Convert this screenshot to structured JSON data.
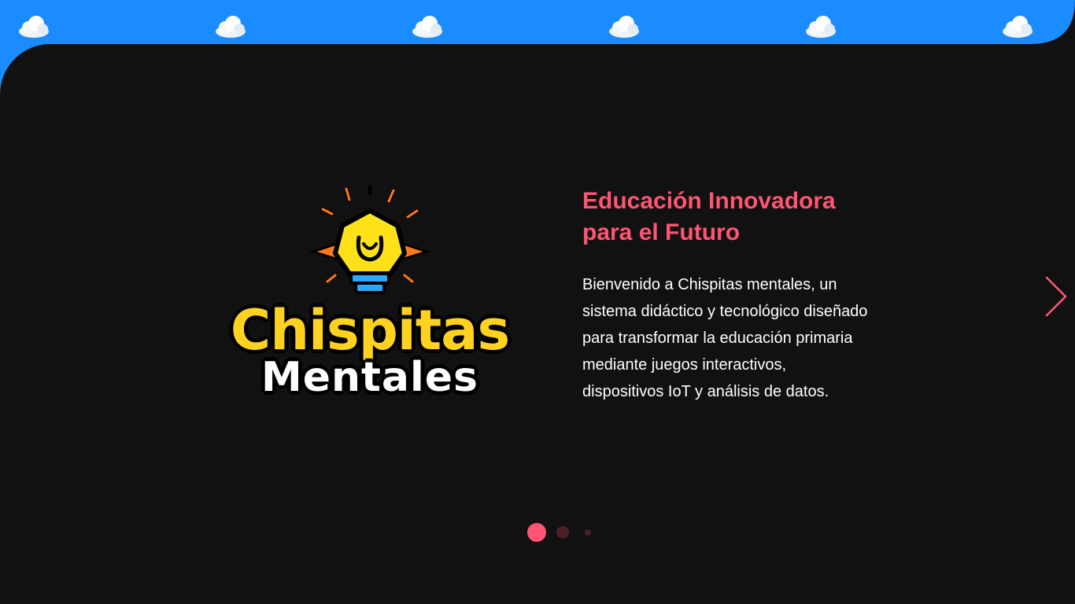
{
  "logo": {
    "line1": "Chispitas",
    "line2": "Mentales"
  },
  "hero": {
    "headline_line1": "Educación Innovadora",
    "headline_line2": "para el Futuro",
    "body_line1": "Bienvenido a Chispitas mentales, un",
    "body_line2": "sistema didáctico y tecnológico diseñado",
    "body_line3": "para transformar la educación primaria",
    "body_line4": "mediante juegos interactivos,",
    "body_line5": "dispositivos IoT y análisis de datos."
  },
  "carousel": {
    "slide_count": 3,
    "active_slide": 1,
    "next_icon": "chevron-right-icon"
  },
  "decor": {
    "clouds": [
      "cloud-icon",
      "cloud-icon",
      "cloud-icon",
      "cloud-icon",
      "cloud-icon",
      "cloud-icon"
    ]
  },
  "colors": {
    "top_band": "#1a8cff",
    "stage": "#111111",
    "accent": "#ff5573",
    "logo_yellow": "#ffd21f",
    "dot_inactive": "#4a2128"
  }
}
